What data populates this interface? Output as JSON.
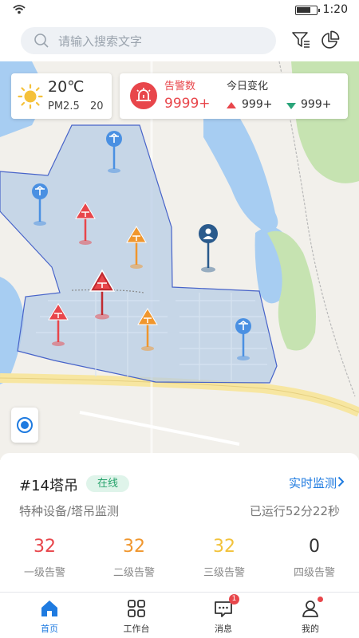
{
  "status_bar": {
    "time": "1:20"
  },
  "search": {
    "placeholder": "请输入搜索文字"
  },
  "weather": {
    "temperature": "20℃",
    "pm_label": "PM2.5",
    "pm_value": "20"
  },
  "alarm_summary": {
    "title": "告警数",
    "count": "9999+",
    "change_title": "今日变化",
    "up_value": "999+",
    "down_value": "999+",
    "up_color": "#e8464b",
    "down_color": "#2aa57a"
  },
  "device": {
    "id": "#14塔吊",
    "status": "在线",
    "live_link": "实时监测",
    "type": "特种设备/塔吊监测",
    "runtime": "已运行52分22秒"
  },
  "stats": [
    {
      "value": "32",
      "label": "一级告警",
      "color": "#e8464b"
    },
    {
      "value": "32",
      "label": "二级告警",
      "color": "#f0962d"
    },
    {
      "value": "32",
      "label": "三级告警",
      "color": "#f2c23a"
    },
    {
      "value": "0",
      "label": "四级告警",
      "color": "#333333"
    }
  ],
  "nav": {
    "home": "首页",
    "workbench": "工作台",
    "messages": "消息",
    "messages_badge": "1",
    "profile": "我的"
  },
  "colors": {
    "accent": "#1f7be0",
    "danger": "#e8464b",
    "warning": "#f0962d",
    "online": "#27a36c"
  }
}
